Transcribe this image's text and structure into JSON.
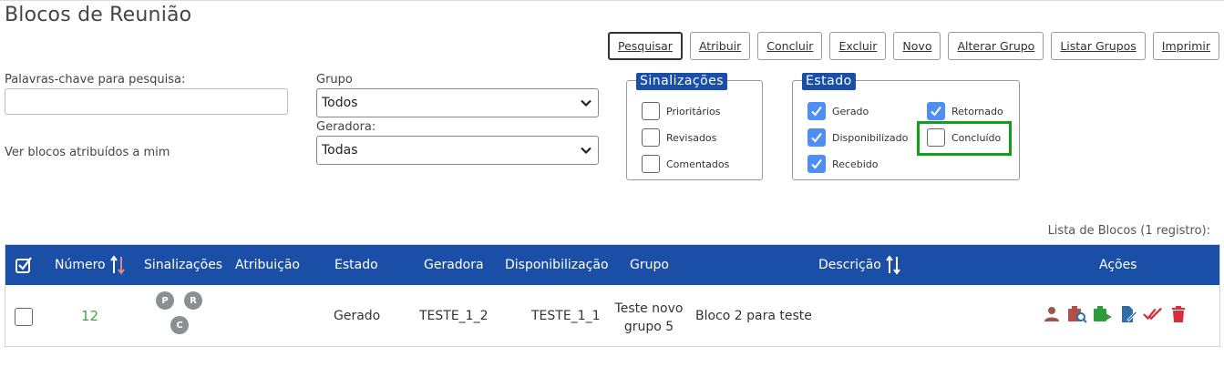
{
  "page": {
    "title": "Blocos de Reunião"
  },
  "toolbar": {
    "buttons": [
      "Pesquisar",
      "Atribuir",
      "Concluir",
      "Excluir",
      "Novo",
      "Alterar Grupo",
      "Listar Grupos",
      "Imprimir"
    ]
  },
  "search": {
    "keywords_label": "Palavras-chave para pesquisa:",
    "keywords_value": "",
    "assigned_to_me_label": "Ver blocos atribuídos a mim",
    "group_label": "Grupo",
    "group_value": "Todos",
    "generator_label": "Geradora:",
    "generator_value": "Todas"
  },
  "flags": {
    "legend": "Sinalizações",
    "items": [
      {
        "label": "Prioritários",
        "checked": false
      },
      {
        "label": "Revisados",
        "checked": false
      },
      {
        "label": "Comentados",
        "checked": false
      }
    ]
  },
  "status": {
    "legend": "Estado",
    "items": [
      {
        "label": "Gerado",
        "checked": true
      },
      {
        "label": "Disponibilizado",
        "checked": true
      },
      {
        "label": "Recebido",
        "checked": true
      },
      {
        "label": "Retornado",
        "checked": true
      },
      {
        "label": "Concluído",
        "checked": false
      }
    ]
  },
  "list": {
    "caption": "Lista de Blocos (1 registro):",
    "headers": {
      "number": "Número",
      "flags": "Sinalizações",
      "assignment": "Atribuição",
      "status": "Estado",
      "generator": "Geradora",
      "availability": "Disponibilização",
      "group": "Grupo",
      "description": "Descrição",
      "actions": "Ações"
    },
    "rows": [
      {
        "number": "12",
        "flag_badges": [
          "P",
          "R",
          "C"
        ],
        "assignment": "",
        "status": "Gerado",
        "generator": "TESTE_1_2",
        "availability": "TESTE_1_1",
        "group": "Teste novo grupo 5",
        "description": "Bloco 2 para teste",
        "actions": [
          "user-icon",
          "search-documents-icon",
          "sign-icon",
          "edit-document-icon",
          "complete-check-icon",
          "trash-icon"
        ]
      }
    ]
  },
  "colors": {
    "header_bg": "#1b4ea7",
    "legend_bg": "#1a4fa8",
    "checkbox_checked": "#4f8ff3",
    "highlight": "#12a01a",
    "number_link": "#3fa742",
    "action_red": "#c0392b",
    "action_green": "#2e9b3e",
    "action_blue": "#2f6fa8"
  }
}
